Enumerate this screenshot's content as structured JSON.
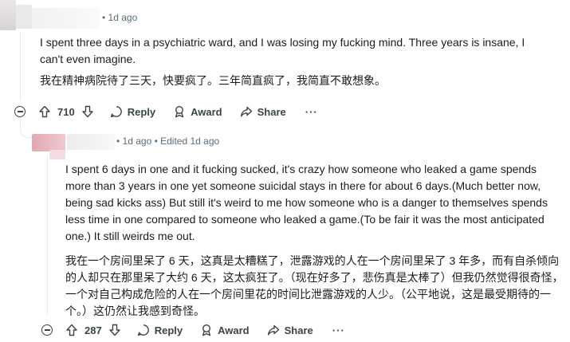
{
  "comments": [
    {
      "meta": "• 1d ago",
      "text_en": "I spent three days in a psychiatric ward, and I was losing my fucking mind. Three years is insane, I can't even imagine.",
      "text_zh": "我在精神病院待了三天，快要疯了。三年简直疯了，我简直不敢想象。",
      "votes": "710",
      "actions": {
        "reply": "Reply",
        "award": "Award",
        "share": "Share",
        "more": "···"
      }
    },
    {
      "meta": "• 1d ago • Edited 1d ago",
      "text_en": "I spent 6 days in one and it fucking sucked, it's crazy how someone who leaked a game spends more than 3 years in one yet someone suicidal stays in there for about 6 days.(Much better now, being sad kicks ass) But still it's weird to me how someone who is a danger to themselves spends less time in one compared to someone who leaked a game.(To be fair it was the most anticipated one.) It still weirds me out.",
      "text_zh": "我在一个房间里呆了 6 天，这真是太糟糕了，泄露游戏的人在一个房间里呆了 3 年多，而有自杀倾向的人却只在那里呆了大约 6 天，这太疯狂了。（现在好多了，悲伤真是太棒了）但我仍然觉得很奇怪，一个对自己构成危险的人在一个房间里花的时间比泄露游戏的人少。（公平地说，这是最受期待的一个。）这仍然让我感到奇怪。",
      "votes": "287",
      "actions": {
        "reply": "Reply",
        "award": "Award",
        "share": "Share",
        "more": "···"
      }
    }
  ],
  "icons": {
    "upvote": "upvote-icon",
    "downvote": "downvote-icon",
    "reply": "reply-bubble-icon",
    "award": "award-icon",
    "share": "share-arrow-icon",
    "collapse": "collapse-minus-icon"
  },
  "colors": {
    "meta": "#576f76",
    "text": "#1c1c1c",
    "action": "#3a4548"
  }
}
